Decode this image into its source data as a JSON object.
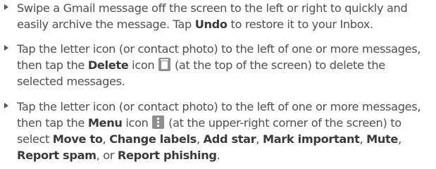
{
  "items": [
    {
      "segments": [
        "Swipe a Gmail message off the screen to the left or right to quickly and easily archive the message. Tap ",
        "Undo",
        " to restore it to your Inbox."
      ]
    },
    {
      "segments": [
        "Tap the letter icon (or contact photo) to the left of one or more messages, then tap the ",
        "Delete",
        " icon ",
        " (at the top of the screen) to delete the selected messages."
      ],
      "icon": "trash-icon"
    },
    {
      "segments": [
        "Tap the letter icon (or contact photo) to the left of one or more messages, then tap the ",
        "Menu",
        " icon ",
        " (at the upper-right corner of the screen) to select ",
        "Move to",
        ", ",
        "Change labels",
        ", ",
        "Add star",
        ", ",
        "Mark important",
        ", ",
        "Mute",
        ", ",
        "Report spam",
        ", or ",
        "Report phishing",
        "."
      ],
      "icon": "menu-icon"
    }
  ]
}
